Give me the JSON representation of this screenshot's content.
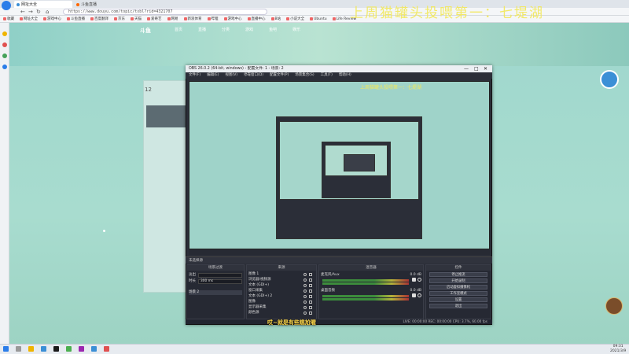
{
  "browser": {
    "tabs": [
      {
        "label": "网址大全"
      },
      {
        "label": "斗鱼直播"
      }
    ],
    "url": "https://www.douyu.com/topic/txbl?rid=4321707",
    "bookmarks": [
      "收藏",
      "网址大全",
      "游戏中心",
      "斗鱼直播",
      "百度翻译",
      "京东",
      "天猫",
      "爱奇艺",
      "网易",
      "新浪体育",
      "哔哩",
      "游戏中心",
      "直播中心",
      "B站",
      "小说大全",
      "Ubuntu",
      "Life Review"
    ]
  },
  "overlay": {
    "watermark": "上周猫罐头投喂第一：七堤湖",
    "subtitle": "哎~就是有些尴尬喔"
  },
  "site": {
    "logo": "斗鱼",
    "nav": [
      "首页",
      "直播",
      "分类",
      "游戏",
      "鱼吧",
      "娱乐"
    ],
    "side_count": "12"
  },
  "obs": {
    "title": "OBS 26.0.2 (64-bit, windows) - 配置文件: 1 - 场景: 2",
    "menu": [
      "文件(F)",
      "编辑(E)",
      "视图(V)",
      "停靠窗口(D)",
      "配置文件(P)",
      "场景集合(S)",
      "工具(T)",
      "帮助(H)"
    ],
    "source_bar": "未选择源",
    "docks": {
      "scenes": {
        "title": "场景过渡",
        "fields": [
          {
            "label": "淡出",
            "value": ""
          },
          {
            "label": "时长",
            "value": "300 ms"
          }
        ],
        "list": [
          "场景 2"
        ]
      },
      "sources": {
        "title": "来源",
        "items": [
          "图像 1",
          "浏览器/视频源",
          "文本 (GDI+)",
          "窗口采集",
          "文本 (GDI+) 2",
          "图像",
          "显示器采集",
          "颜色源"
        ]
      },
      "mixer": {
        "title": "混音器",
        "channels": [
          {
            "name": "麦克风/Aux",
            "db": "0.0 dB"
          },
          {
            "name": "桌面音频",
            "db": "0.0 dB"
          }
        ]
      },
      "controls": {
        "title": "控件",
        "buttons": [
          "停止推流",
          "开始录制",
          "启动虚拟摄像机",
          "工作室模式",
          "设置",
          "退出"
        ]
      }
    },
    "footer": "LIVE: 00:00:00   REC: 00:00:00   CPU: 3.7%, 60.00 fps"
  },
  "taskbar": {
    "time": "09:31",
    "date": "2021/3/9"
  },
  "colors": {
    "watermark": "#f2e85a",
    "obs_bg": "#2b2e38",
    "page_bg": "#9fd7cd"
  }
}
